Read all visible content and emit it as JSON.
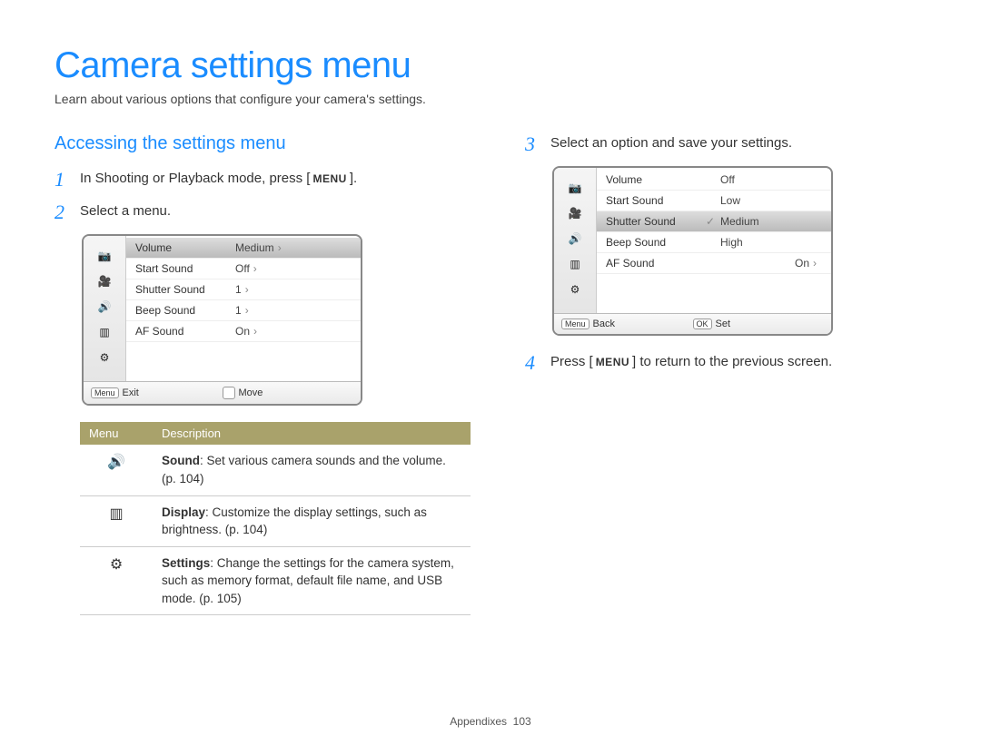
{
  "page": {
    "title": "Camera settings menu",
    "subtitle": "Learn about various options that configure your camera's settings.",
    "footer_label": "Appendixes",
    "footer_page": "103"
  },
  "section_heading": "Accessing the settings menu",
  "steps": {
    "s1": {
      "num": "1",
      "text_pre": "In Shooting or Playback mode, press [",
      "btn": "MENU",
      "text_post": "]."
    },
    "s2": {
      "num": "2",
      "text": "Select a menu."
    },
    "s3": {
      "num": "3",
      "text": "Select an option and save your settings."
    },
    "s4": {
      "num": "4",
      "text_pre": "Press [",
      "btn": "MENU",
      "text_post": "] to return to the previous screen."
    }
  },
  "lcd1": {
    "rows": [
      {
        "label": "Volume",
        "value": "Medium"
      },
      {
        "label": "Start Sound",
        "value": "Off"
      },
      {
        "label": "Shutter Sound",
        "value": "1"
      },
      {
        "label": "Beep Sound",
        "value": "1"
      },
      {
        "label": "AF Sound",
        "value": "On"
      }
    ],
    "footer": {
      "left_key": "Menu",
      "left_label": "Exit",
      "right_label": "Move"
    }
  },
  "lcd2": {
    "rows": [
      {
        "label": "Volume",
        "value": "Off"
      },
      {
        "label": "Start Sound",
        "value": "Low"
      },
      {
        "label": "Shutter Sound",
        "value": "Medium",
        "selected": true
      },
      {
        "label": "Beep Sound",
        "value": "High"
      },
      {
        "label": "AF Sound",
        "value": "On",
        "arrow": true
      }
    ],
    "footer": {
      "left_key": "Menu",
      "left_label": "Back",
      "right_key": "OK",
      "right_label": "Set"
    }
  },
  "desc_table": {
    "head": {
      "col1": "Menu",
      "col2": "Description"
    },
    "rows": [
      {
        "icon": "sound-icon",
        "bold": "Sound",
        "text": ": Set various camera sounds and the volume. (p. 104)"
      },
      {
        "icon": "display-icon",
        "bold": "Display",
        "text": ": Customize the display settings, such as brightness. (p. 104)"
      },
      {
        "icon": "settings-icon",
        "bold": "Settings",
        "text": ": Change the settings for the camera system, such as memory format, default file name, and USB mode. (p. 105)"
      }
    ]
  },
  "icons": {
    "camera": "📷",
    "video": "🎥",
    "sound": "🔊",
    "display": "▥",
    "settings": "⚙"
  }
}
